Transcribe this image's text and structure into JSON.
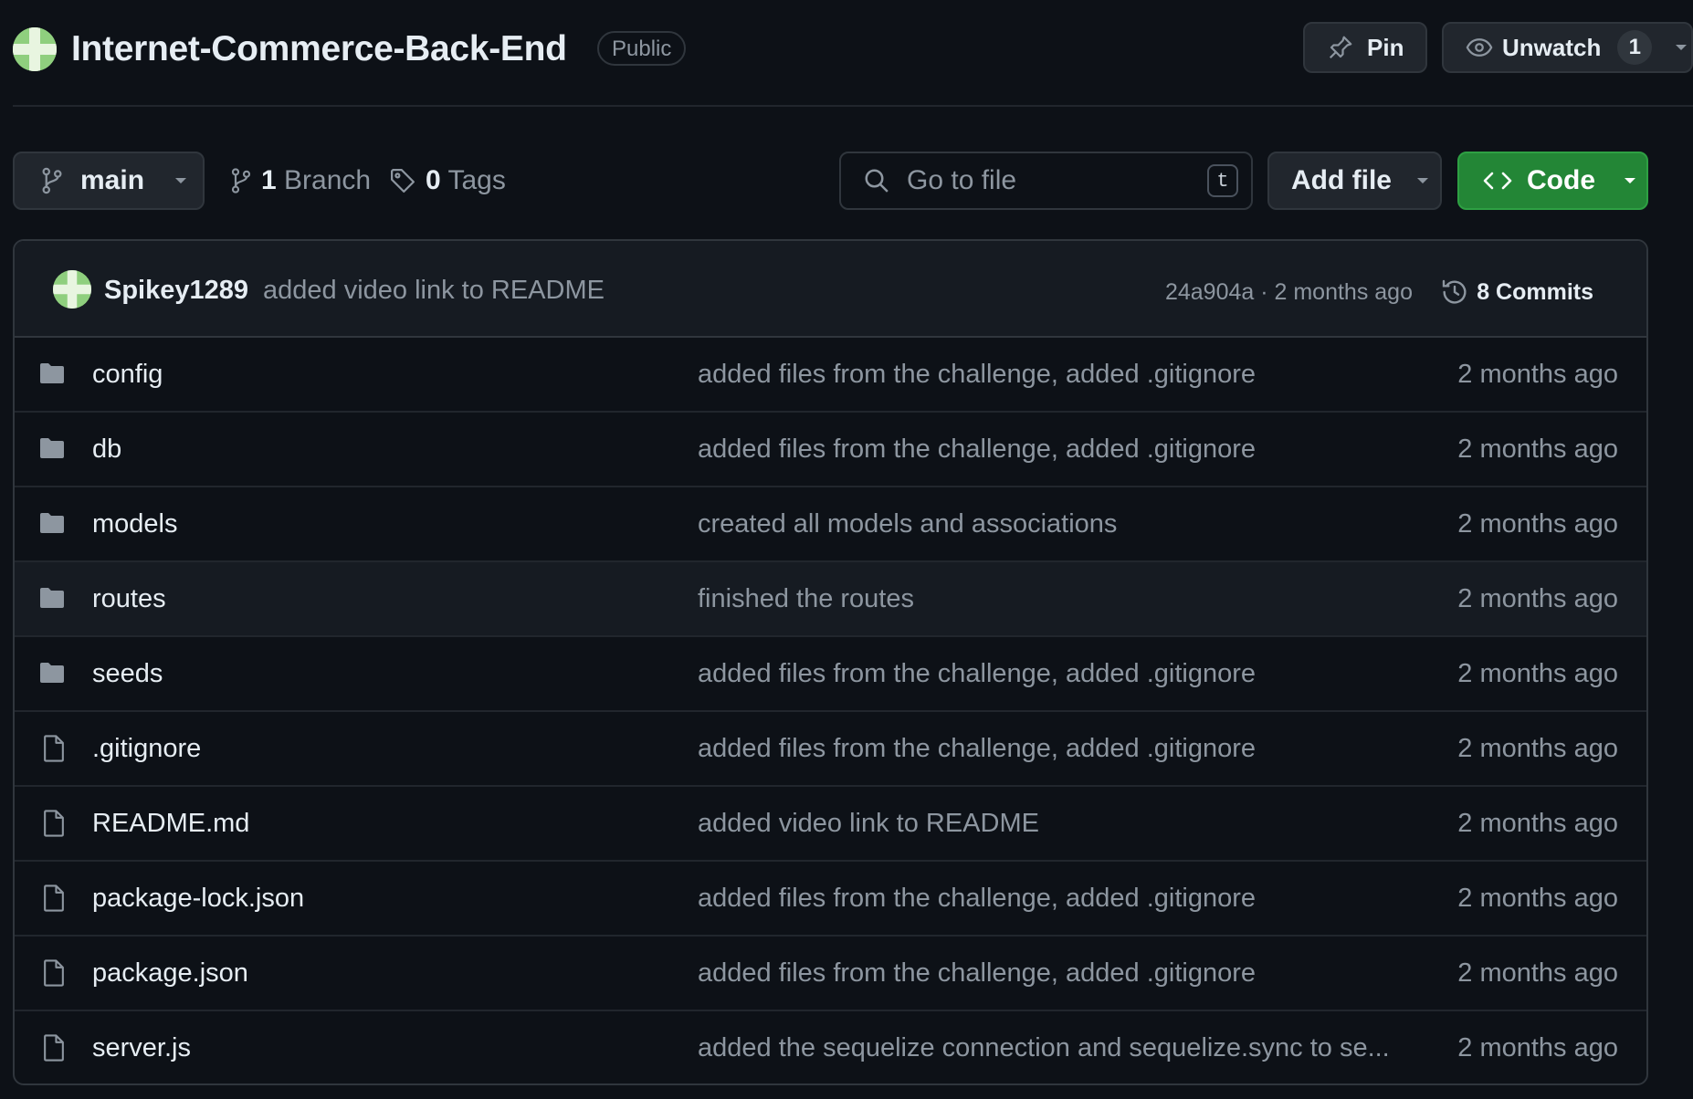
{
  "repo": {
    "name": "Internet-Commerce-Back-End",
    "visibility": "Public",
    "pin_label": "Pin",
    "unwatch_label": "Unwatch",
    "watch_count": "1"
  },
  "toolbar": {
    "branch": "main",
    "branch_count": "1",
    "branch_word": "Branch",
    "tag_count": "0",
    "tag_word": "Tags",
    "search_placeholder": "Go to file",
    "search_shortcut": "t",
    "add_file_label": "Add file",
    "code_label": "Code"
  },
  "latest_commit": {
    "author": "Spikey1289",
    "message": "added video link to README",
    "hash_and_time": "24a904a · 2 months ago",
    "commits_label": "8 Commits"
  },
  "files": [
    {
      "name": "config",
      "type": "folder",
      "message": "added files from the challenge, added .gitignore",
      "date": "2 months ago"
    },
    {
      "name": "db",
      "type": "folder",
      "message": "added files from the challenge, added .gitignore",
      "date": "2 months ago"
    },
    {
      "name": "models",
      "type": "folder",
      "message": "created all models and associations",
      "date": "2 months ago"
    },
    {
      "name": "routes",
      "type": "folder",
      "message": "finished the routes",
      "date": "2 months ago"
    },
    {
      "name": "seeds",
      "type": "folder",
      "message": "added files from the challenge, added .gitignore",
      "date": "2 months ago"
    },
    {
      "name": ".gitignore",
      "type": "file",
      "message": "added files from the challenge, added .gitignore",
      "date": "2 months ago"
    },
    {
      "name": "README.md",
      "type": "file",
      "message": "added video link to README",
      "date": "2 months ago"
    },
    {
      "name": "package-lock.json",
      "type": "file",
      "message": "added files from the challenge, added .gitignore",
      "date": "2 months ago"
    },
    {
      "name": "package.json",
      "type": "file",
      "message": "added files from the challenge, added .gitignore",
      "date": "2 months ago"
    },
    {
      "name": "server.js",
      "type": "file",
      "message": "added the sequelize connection and sequelize.sync to se...",
      "date": "2 months ago"
    }
  ],
  "icons": {
    "folder": "folder-icon",
    "file": "file-icon"
  },
  "colors": {
    "background": "#0d1117",
    "border": "#30363d",
    "muted_text": "#8d96a0",
    "code_button": "#238636",
    "folder_icon": "#8d96a0"
  }
}
